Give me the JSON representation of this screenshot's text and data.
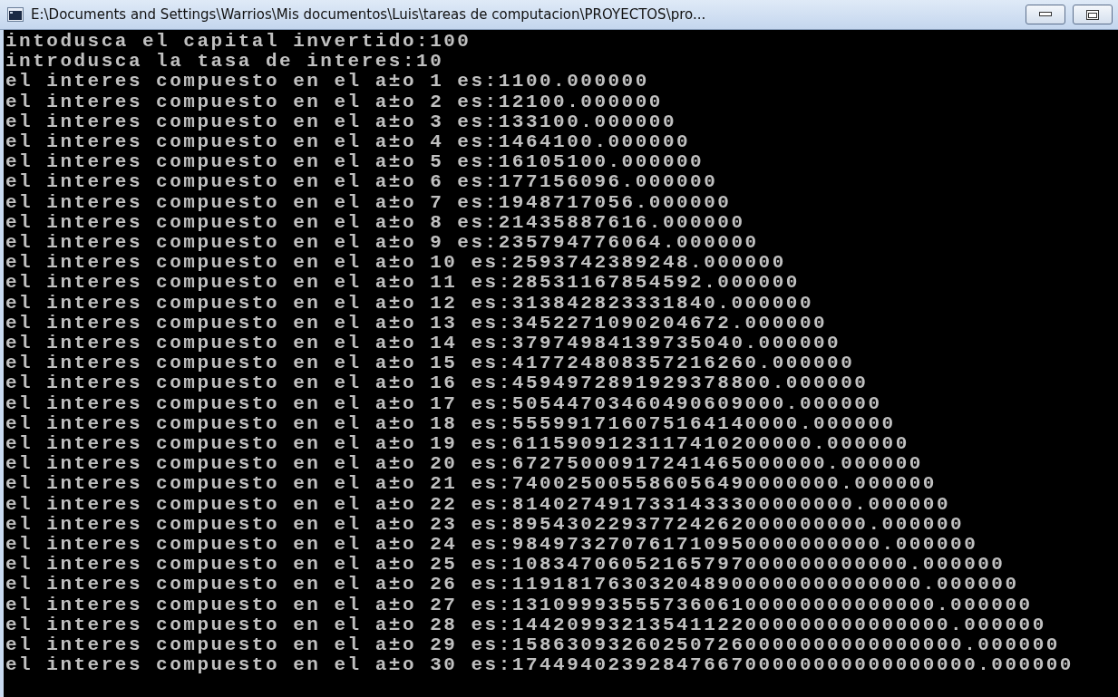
{
  "window": {
    "title": "E:\\Documents and Settings\\Warrios\\Mis documentos\\Luis\\tareas de computacion\\PROYECTOS\\pro..."
  },
  "console": {
    "lines": [
      "intodusca el capital invertido:100",
      "introdusca la tasa de interes:10",
      "el interes compuesto en el a±o 1 es:1100.000000",
      "el interes compuesto en el a±o 2 es:12100.000000",
      "el interes compuesto en el a±o 3 es:133100.000000",
      "el interes compuesto en el a±o 4 es:1464100.000000",
      "el interes compuesto en el a±o 5 es:16105100.000000",
      "el interes compuesto en el a±o 6 es:177156096.000000",
      "el interes compuesto en el a±o 7 es:1948717056.000000",
      "el interes compuesto en el a±o 8 es:21435887616.000000",
      "el interes compuesto en el a±o 9 es:235794776064.000000",
      "el interes compuesto en el a±o 10 es:2593742389248.000000",
      "el interes compuesto en el a±o 11 es:28531167854592.000000",
      "el interes compuesto en el a±o 12 es:313842823331840.000000",
      "el interes compuesto en el a±o 13 es:3452271090204672.000000",
      "el interes compuesto en el a±o 14 es:37974984139735040.000000",
      "el interes compuesto en el a±o 15 es:417724808357216260.000000",
      "el interes compuesto en el a±o 16 es:4594972891929378800.000000",
      "el interes compuesto en el a±o 17 es:50544703460490609000.000000",
      "el interes compuesto en el a±o 18 es:555991716075164140000.000000",
      "el interes compuesto en el a±o 19 es:6115909123117410200000.000000",
      "el interes compuesto en el a±o 20 es:67275000917241465000000.000000",
      "el interes compuesto en el a±o 21 es:740025005586056490000000.000000",
      "el interes compuesto en el a±o 22 es:8140274917331433300000000.000000",
      "el interes compuesto en el a±o 23 es:89543022937724262000000000.000000",
      "el interes compuesto en el a±o 24 es:984973270761710950000000000.000000",
      "el interes compuesto en el a±o 25 es:10834706052165797000000000000.000000",
      "el interes compuesto en el a±o 26 es:119181763032048900000000000000.000000",
      "el interes compuesto en el a±o 27 es:1310999355573606100000000000000.000000",
      "el interes compuesto en el a±o 28 es:14420993213541122000000000000000.000000",
      "el interes compuesto en el a±o 29 es:158630932602507260000000000000000.000000",
      "el interes compuesto en el a±o 30 es:1744940239284766700000000000000000.000000"
    ]
  }
}
